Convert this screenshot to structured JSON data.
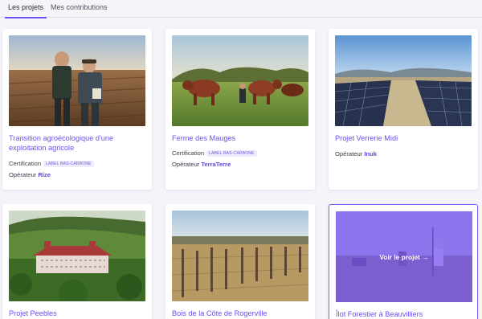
{
  "tabs": [
    {
      "label": "Les projets",
      "active": true
    },
    {
      "label": "Mes contributions",
      "active": false
    }
  ],
  "cards": [
    {
      "title": "Transition agroécologique d'une exploitation agricole",
      "certification_label": "Certification",
      "badge": "LABEL BAS-CARBONE",
      "operator_label": "Opérateur",
      "operator": "Rize"
    },
    {
      "title": "Ferme des Mauges",
      "certification_label": "Certification",
      "badge": "LABEL BAS-CARBONE",
      "operator_label": "Opérateur",
      "operator": "TerraTerre"
    },
    {
      "title": "Projet Verrerie Midi",
      "operator_label": "Opérateur",
      "operator": "Inuk"
    },
    {
      "title": "Projet Peebles"
    },
    {
      "title": "Bois de la Côte de Rogerville"
    },
    {
      "title": "Îlot Forestier à Beauvilliers",
      "hover_cta": "Voir le projet →"
    }
  ],
  "colors": {
    "accent": "#6a50f0",
    "badge_bg": "#efebff",
    "overlay": "#7654f8"
  }
}
